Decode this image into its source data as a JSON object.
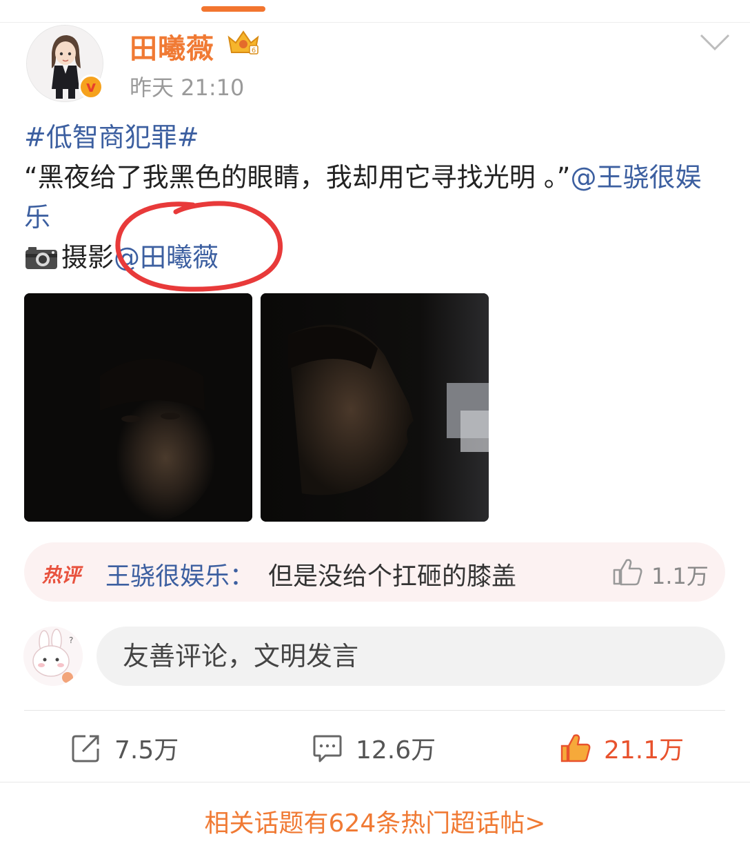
{
  "post": {
    "author": "田曦薇",
    "time": "昨天 21:10",
    "hashtag": "#低智商犯罪#",
    "quote": "“黑夜给了我黑色的眼睛，我却用它寻找光明 。”",
    "mention_1": "@王骁很娱乐",
    "photo_prefix": "摄影",
    "mention_2": "@田曦薇"
  },
  "hot_comment": {
    "tag": "热评",
    "author": "王骁很娱乐",
    "separator": "：",
    "text": "但是没给个扛砸的膝盖",
    "likes": "1.1万"
  },
  "comment_box": {
    "placeholder": "友善评论，文明发言"
  },
  "actions": {
    "reposts": "7.5万",
    "comments": "12.6万",
    "likes": "21.1万"
  },
  "related": {
    "link_text": "相关话题有624条热门超话帖>"
  },
  "colors": {
    "accent": "#f07a34",
    "link": "#3c5fa0",
    "like_active": "#e8522d",
    "annotation_circle": "#e83a3a"
  }
}
